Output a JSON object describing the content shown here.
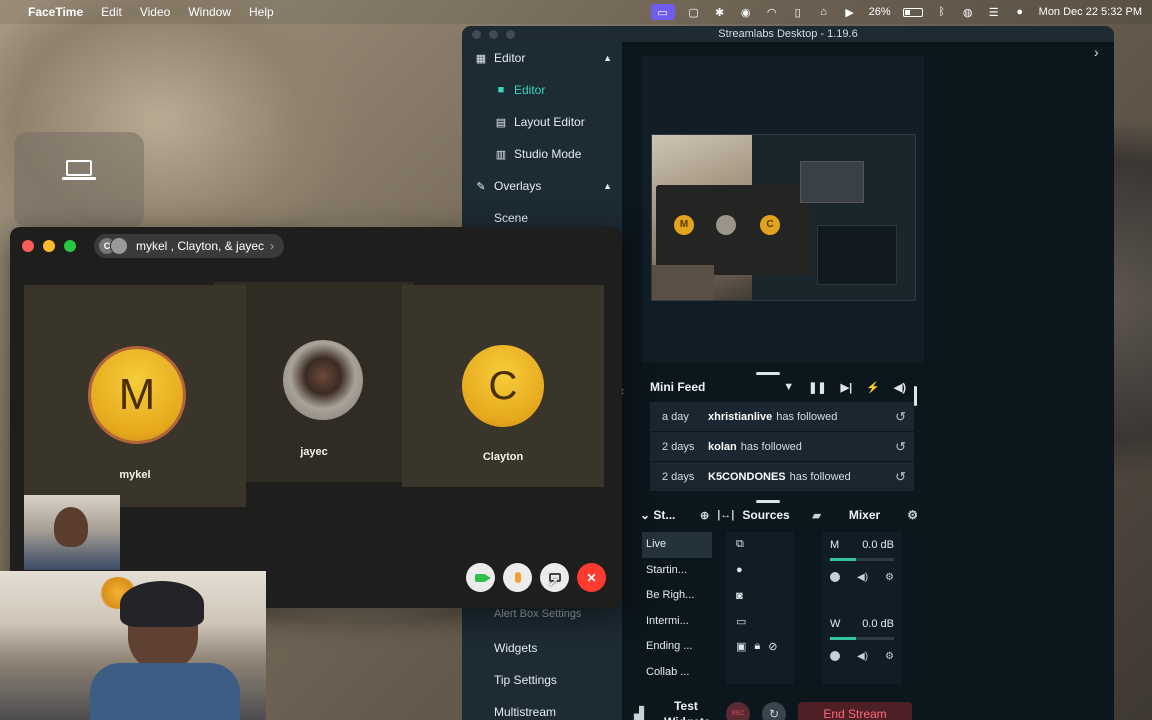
{
  "menubar": {
    "app_name": "FaceTime",
    "menus": [
      "Edit",
      "Video",
      "Window",
      "Help"
    ],
    "battery_percent": "26%",
    "datetime": "Mon Dec 22  5:32 PM"
  },
  "streamlabs": {
    "title": "Streamlabs Desktop - 1.19.6",
    "sidebar": {
      "editor_section": "Editor",
      "editor_item": "Editor",
      "layout_editor": "Layout Editor",
      "studio_mode": "Studio Mode",
      "overlays_section": "Overlays",
      "scene_item": "Scene",
      "alert_box_settings": "Alert Box Settings",
      "widgets": "Widgets",
      "tip_settings": "Tip Settings",
      "multistream": "Multistream"
    },
    "mini_feed": {
      "title": "Mini Feed",
      "events": [
        {
          "time": "a day",
          "user": "xhristianlive",
          "action": "has followed"
        },
        {
          "time": "2 days",
          "user": "kolan",
          "action": "has followed"
        },
        {
          "time": "2 days",
          "user": "K5CONDONES",
          "action": "has followed"
        }
      ]
    },
    "scenes": {
      "title": "St...",
      "items": [
        "Live",
        "Startin...",
        "Be Righ...",
        "Intermi...",
        "Ending ...",
        "Collab ..."
      ]
    },
    "sources": {
      "title": "Sources"
    },
    "mixer": {
      "title": "Mixer",
      "channels": [
        {
          "name": "M",
          "level": "0.0 dB"
        },
        {
          "name": "W",
          "level": "0.0 dB"
        }
      ]
    },
    "footer": {
      "test_widgets": "Test Widgets",
      "rec_label": "REC",
      "end_stream": "End Stream"
    },
    "preview": {
      "avatar_left": "M",
      "avatar_right": "C"
    }
  },
  "facetime": {
    "call_title": "mykel , Clayton, & jayec",
    "pill_initial": "C",
    "participants": [
      {
        "name": "mykel",
        "initial": "M"
      },
      {
        "name": "jayec",
        "initial": ""
      },
      {
        "name": "Clayton",
        "initial": "C"
      }
    ]
  },
  "colors": {
    "streamlabs_accent": "#38d7b5",
    "end_stream": "#ff6b7d",
    "avatar_yellow": "#e6a81d",
    "facetime_end": "#fe3b30"
  }
}
